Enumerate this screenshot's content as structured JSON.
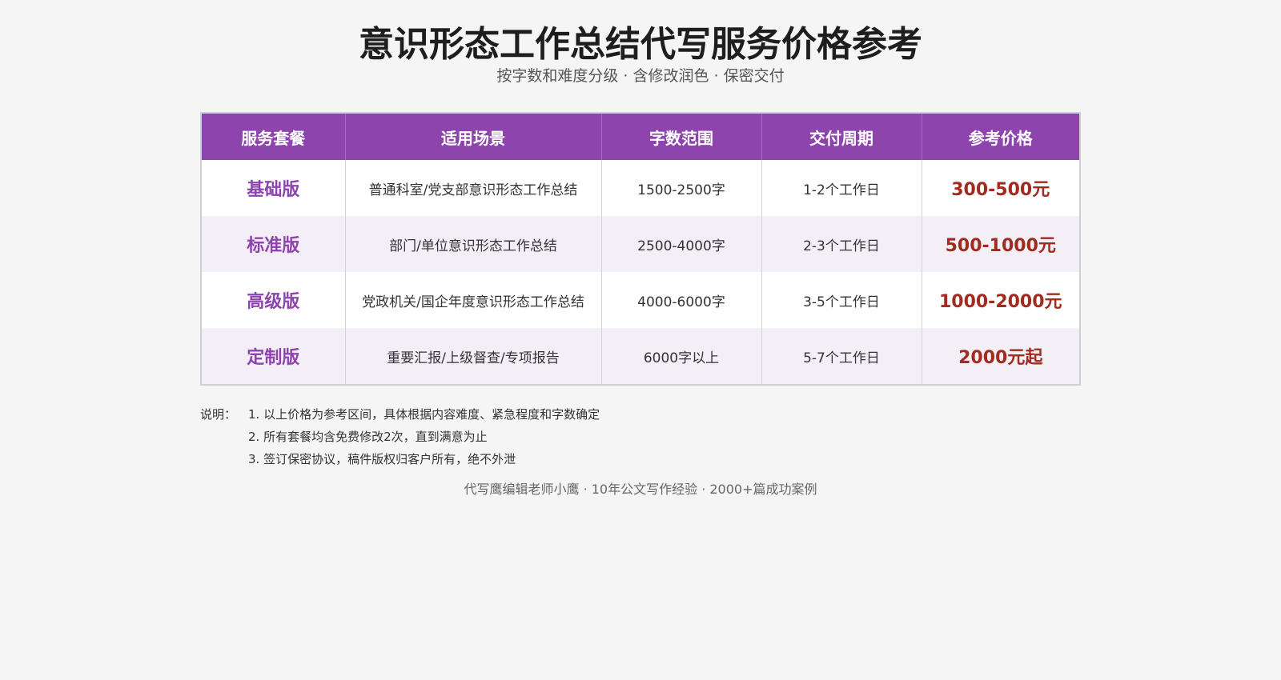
{
  "header": {
    "title": "意识形态工作总结代写服务价格参考",
    "subtitle": "按字数和难度分级 · 含修改润色 · 保密交付"
  },
  "table": {
    "columns": [
      "服务套餐",
      "适用场景",
      "字数范围",
      "交付周期",
      "参考价格"
    ],
    "rows": [
      {
        "package": "基础版",
        "scene": "普通科室/党支部意识形态工作总结",
        "words": "1500-2500字",
        "period": "1-2个工作日",
        "price": "300-500元"
      },
      {
        "package": "标准版",
        "scene": "部门/单位意识形态工作总结",
        "words": "2500-4000字",
        "period": "2-3个工作日",
        "price": "500-1000元"
      },
      {
        "package": "高级版",
        "scene": "党政机关/国企年度意识形态工作总结",
        "words": "4000-6000字",
        "period": "3-5个工作日",
        "price": "1000-2000元"
      },
      {
        "package": "定制版",
        "scene": "重要汇报/上级督查/专项报告",
        "words": "6000字以上",
        "period": "5-7个工作日",
        "price": "2000元起"
      }
    ]
  },
  "notes": {
    "label": "说明：",
    "items": [
      "1. 以上价格为参考区间，具体根据内容难度、紧急程度和字数确定",
      "2. 所有套餐均含免费修改2次，直到满意为止",
      "3. 签订保密协议，稿件版权归客户所有，绝不外泄"
    ]
  },
  "footer": {
    "text": "代写鹰编辑老师小鹰 · 10年公文写作经验 · 2000+篇成功案例"
  },
  "colors": {
    "header_bg": "#8e44ad",
    "package_text": "#8e44ad",
    "price_text": "#a12b1e",
    "even_row_bg": "#f4eef7"
  }
}
